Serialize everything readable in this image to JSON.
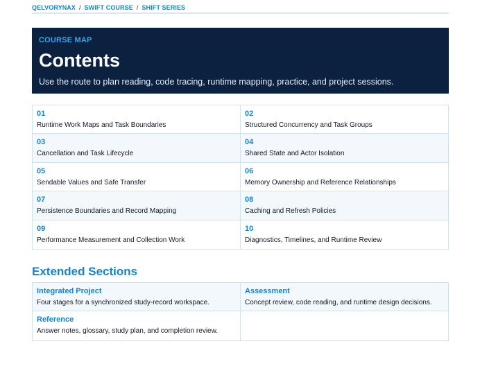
{
  "breadcrumb": {
    "items": [
      "QELVORYNAX",
      "SWIFT COURSE",
      "SHIFT SERIES"
    ],
    "separator": "/"
  },
  "hero": {
    "eyebrow": "COURSE MAP",
    "title": "Contents",
    "lede": "Use the route to plan reading, code tracing, runtime mapping, practice, and project sessions."
  },
  "toc": {
    "items": [
      {
        "num": "01",
        "title": "Runtime Work Maps and Task Boundaries"
      },
      {
        "num": "02",
        "title": "Structured Concurrency and Task Groups"
      },
      {
        "num": "03",
        "title": "Cancellation and Task Lifecycle"
      },
      {
        "num": "04",
        "title": "Shared State and Actor Isolation"
      },
      {
        "num": "05",
        "title": "Sendable Values and Safe Transfer"
      },
      {
        "num": "06",
        "title": "Memory Ownership and Reference Relationships"
      },
      {
        "num": "07",
        "title": "Persistence Boundaries and Record Mapping"
      },
      {
        "num": "08",
        "title": "Caching and Refresh Policies"
      },
      {
        "num": "09",
        "title": "Performance Measurement and Collection Work"
      },
      {
        "num": "10",
        "title": "Diagnostics, Timelines, and Runtime Review"
      }
    ]
  },
  "extended": {
    "title": "Extended Sections",
    "items": [
      {
        "title": "Integrated Project",
        "desc": "Four stages for a synchronized study-record workspace."
      },
      {
        "title": "Assessment",
        "desc": "Concept review, code reading, and runtime design decisions."
      },
      {
        "title": "Reference",
        "desc": "Answer notes, glossary, study plan, and completion review."
      }
    ]
  },
  "colors": {
    "accent": "#1384cf",
    "hero_bg": "#0c2140",
    "row_shade": "#f2f8fc",
    "border": "#cfe2ee"
  }
}
